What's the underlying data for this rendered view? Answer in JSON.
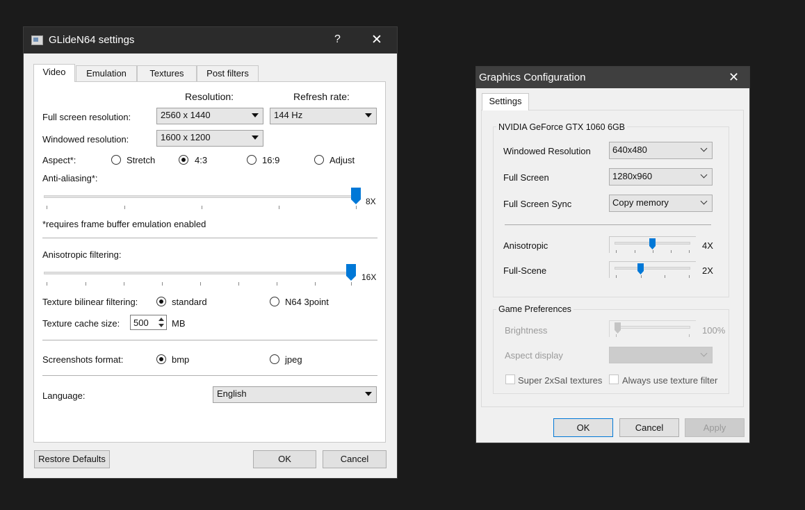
{
  "glide": {
    "title": "GLideN64 settings",
    "help_glyph": "?",
    "close_glyph": "✕",
    "tabs": [
      "Video",
      "Emulation",
      "Textures",
      "Post filters"
    ],
    "resolution_header": "Resolution:",
    "refresh_header": "Refresh rate:",
    "fullscreen_label": "Full screen resolution:",
    "fullscreen_value": "2560 x 1440",
    "refresh_value": "144 Hz",
    "windowed_label": "Windowed resolution:",
    "windowed_value": "1600 x 1200",
    "aspect_label": "Aspect*:",
    "aspect_options": [
      "Stretch",
      "4:3",
      "16:9",
      "Adjust"
    ],
    "aspect_selected": "4:3",
    "antialiasing_label": "Anti-aliasing*:",
    "antialiasing_value": "8X",
    "antialiasing_level": 1.0,
    "note": "*requires frame buffer emulation enabled",
    "anisotropic_label": "Anisotropic filtering:",
    "anisotropic_value": "16X",
    "anisotropic_level": 1.0,
    "bilinear_label": "Texture bilinear filtering:",
    "bilinear_options": [
      "standard",
      "N64 3point"
    ],
    "bilinear_selected": "standard",
    "cache_label": "Texture cache size:",
    "cache_value": "500",
    "cache_unit": "MB",
    "screenshot_label": "Screenshots format:",
    "screenshot_options": [
      "bmp",
      "jpeg"
    ],
    "screenshot_selected": "bmp",
    "language_label": "Language:",
    "language_value": "English",
    "restore_button": "Restore Defaults",
    "ok_button": "OK",
    "cancel_button": "Cancel"
  },
  "gfx": {
    "title": "Graphics Configuration",
    "close_glyph": "✕",
    "tab": "Settings",
    "gpu_group": "NVIDIA GeForce GTX 1060 6GB",
    "windowed_label": "Windowed Resolution",
    "windowed_value": "640x480",
    "fullscreen_label": "Full Screen",
    "fullscreen_value": "1280x960",
    "sync_label": "Full Screen Sync",
    "sync_value": "Copy memory",
    "aniso_label": "Anisotropic",
    "aniso_value": "4X",
    "aniso_level": 0.5,
    "fullscene_label": "Full-Scene",
    "fullscene_value": "2X",
    "fullscene_level": 0.33,
    "prefs_group": "Game Preferences",
    "brightness_label": "Brightness",
    "brightness_value": "100%",
    "brightness_level": 0.0,
    "aspect_label": "Aspect display",
    "aspect_value": "",
    "super_label": "Super 2xSaI textures",
    "texfilter_label": "Always use texture filter",
    "ok_button": "OK",
    "cancel_button": "Cancel",
    "apply_button": "Apply"
  },
  "colors": {
    "accent": "#0078d7",
    "titlebar_dark": "#2b2b2b",
    "titlebar_gray": "#3f3f3f",
    "background": "#1b1b1b"
  }
}
